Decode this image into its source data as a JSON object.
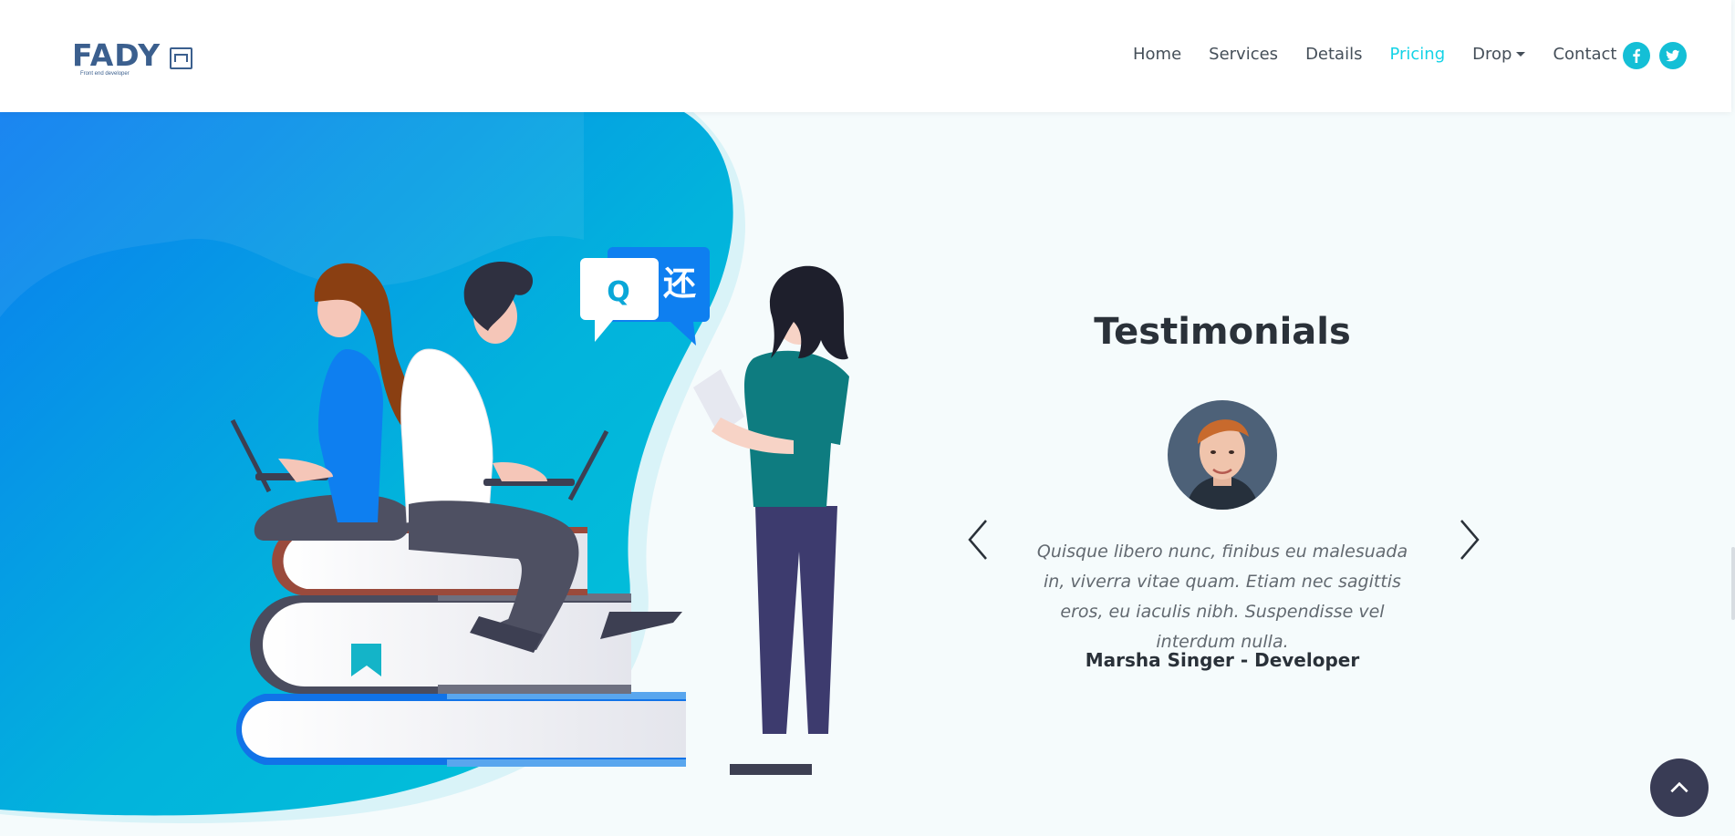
{
  "brand": {
    "name": "FADY",
    "tagline": "Front end developer",
    "colors": {
      "accent": "#14d3e6",
      "heading": "#2a3139",
      "text": "#454f59",
      "logo": "#3b5f8e",
      "dark_button": "#393c55"
    }
  },
  "nav": {
    "items": [
      {
        "label": "Home"
      },
      {
        "label": "Services"
      },
      {
        "label": "Details"
      },
      {
        "label": "Pricing",
        "active": true
      },
      {
        "label": "Drop",
        "has_dropdown": true
      },
      {
        "label": "Contact"
      }
    ],
    "social": [
      {
        "icon": "facebook-icon"
      },
      {
        "icon": "twitter-icon"
      }
    ]
  },
  "hero": {
    "illustration_icons": [
      "search-bubble-icon",
      "translate-bubble-icon",
      "bookmark-icon"
    ],
    "bubble_latin": "Q",
    "bubble_cjk": "还"
  },
  "testimonials": {
    "title": "Testimonials",
    "quote": "Quisque libero nunc, finibus eu malesuada in, viverra vitae quam. Etiam nec sagittis eros, eu iaculis nibh. Suspendisse vel interdum nulla.",
    "author": "Marsha Singer - Developer",
    "prev_icon": "chevron-left-icon",
    "next_icon": "chevron-right-icon"
  },
  "back_to_top_icon": "chevron-up-icon"
}
